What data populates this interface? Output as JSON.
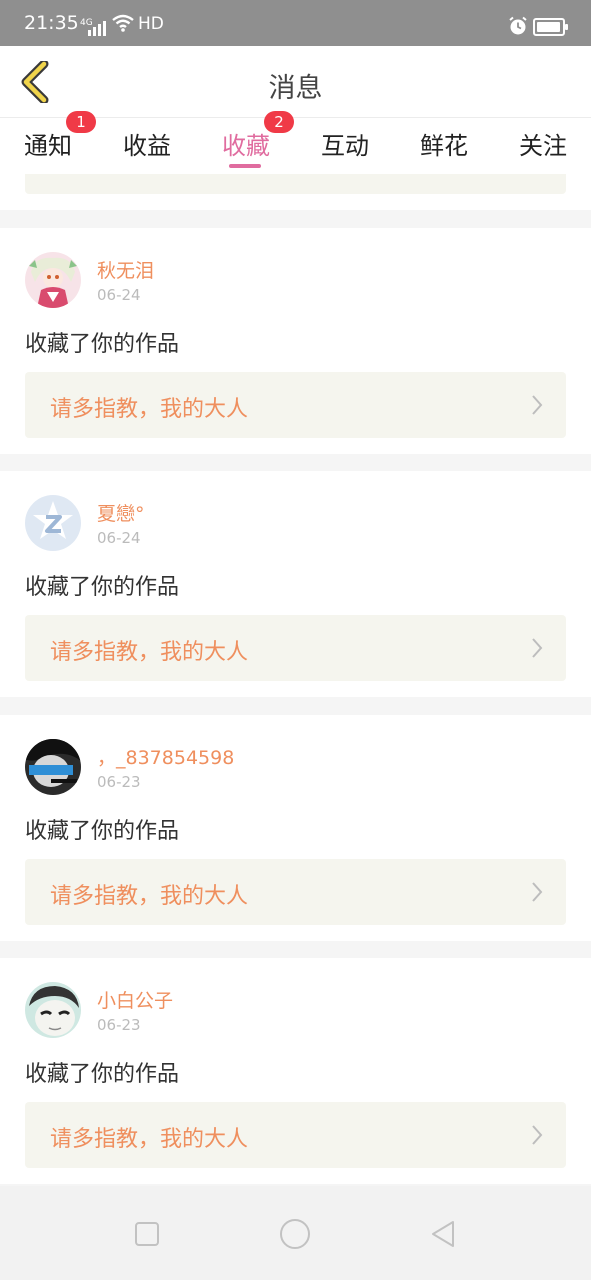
{
  "status_bar": {
    "time": "21:35",
    "network": "4G",
    "hd": "HD"
  },
  "header": {
    "title": "消息"
  },
  "tabs": [
    {
      "label": "通知",
      "badge": "1"
    },
    {
      "label": "收益"
    },
    {
      "label": "收藏",
      "badge": "2",
      "active": true
    },
    {
      "label": "互动"
    },
    {
      "label": "鲜花"
    },
    {
      "label": "关注"
    }
  ],
  "messages": [
    {
      "username": "秋无泪",
      "date": "06-24",
      "action": "收藏了你的作品",
      "quote": "请多指教，我的大人",
      "avatar": "anime-girl-avatar"
    },
    {
      "username": "夏戀°",
      "date": "06-24",
      "action": "收藏了你的作品",
      "quote": "请多指教，我的大人",
      "avatar": "default-z-avatar"
    },
    {
      "username": "，_837854598",
      "date": "06-23",
      "action": "收藏了你的作品",
      "quote": "请多指教，我的大人",
      "avatar": "dark-photo-avatar"
    },
    {
      "username": "小白公子",
      "date": "06-23",
      "action": "收藏了你的作品",
      "quote": "请多指教，我的大人",
      "avatar": "sketch-face-avatar"
    }
  ],
  "colors": {
    "accent": "#e06c9f",
    "username": "#ef8f5e",
    "badge": "#f03a47",
    "quote_bg": "#f5f5ee",
    "back_icon": "#f0d44b"
  }
}
